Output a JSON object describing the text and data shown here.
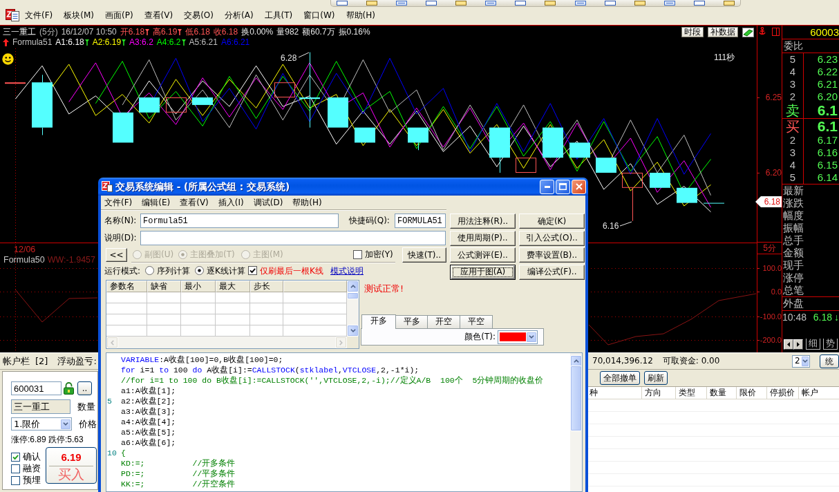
{
  "menu": [
    "文件(F)",
    "板块(M)",
    "画面(P)",
    "查看(V)",
    "交易(O)",
    "分析(A)",
    "工具(T)",
    "窗口(W)",
    "帮助(H)"
  ],
  "chart": {
    "quote": [
      {
        "kind": "name",
        "text": "三一重工",
        "marker": false
      },
      {
        "kind": "period",
        "text": "(5分)",
        "marker": false
      },
      {
        "kind": "info",
        "text": "16/12/07 10:50",
        "marker": false
      },
      {
        "kind": "price",
        "text": "开6.18",
        "marker": true
      },
      {
        "kind": "price",
        "text": "高6.19",
        "marker": true
      },
      {
        "kind": "price",
        "text": "低6.18",
        "marker": false
      },
      {
        "kind": "price",
        "text": "收6.18",
        "marker": false
      },
      {
        "kind": "stat",
        "text": "换0.00%",
        "marker": false
      },
      {
        "kind": "stat",
        "text": "量982",
        "marker": false
      },
      {
        "kind": "stat",
        "text": "额60.7万",
        "marker": false
      },
      {
        "kind": "stat",
        "text": "振0.16%",
        "marker": false
      }
    ],
    "buttons": [
      "时段",
      "补数据"
    ],
    "formula": "Formula51",
    "indicators": [
      {
        "label": "A1:6.18",
        "color": "#ffffff",
        "marker": true
      },
      {
        "label": "A2:6.19",
        "color": "#ffff00",
        "marker": true
      },
      {
        "label": "A3:6.2",
        "color": "#ff00ff",
        "marker": false
      },
      {
        "label": "A4:6.2",
        "color": "#00ff00",
        "marker": true
      },
      {
        "label": "A5:6.21",
        "color": "#c0c0c0",
        "marker": false
      },
      {
        "label": "A6:6.21",
        "color": "#0000ff",
        "marker": false
      }
    ],
    "countdown": "111秒",
    "high_label": "6.28",
    "low_label": "6.16",
    "date_label": "12/06",
    "lower_formula": "Formula50",
    "lower_value": "WW:-1.9457"
  },
  "axis": {
    "prices": [
      "6.25",
      "6.20"
    ],
    "last_price": "6.18",
    "period": "5分",
    "lower": [
      "100.0",
      "0.0",
      "-100.0",
      "-200.0"
    ]
  },
  "quote_panel": {
    "code": "60003",
    "ratio_label": "委比",
    "asks": [
      {
        "kind": "depth",
        "level": "5",
        "price": "6.23"
      },
      {
        "kind": "depth",
        "level": "4",
        "price": "6.22"
      },
      {
        "kind": "depth",
        "level": "3",
        "price": "6.21"
      },
      {
        "kind": "depth",
        "level": "2",
        "price": "6.20"
      },
      {
        "kind": "best",
        "level": "卖",
        "price": "6.1"
      }
    ],
    "bids": [
      {
        "kind": "best",
        "level": "买",
        "price": "6.1"
      },
      {
        "kind": "depth",
        "level": "2",
        "price": "6.17"
      },
      {
        "kind": "depth",
        "level": "3",
        "price": "6.16"
      },
      {
        "kind": "depth",
        "level": "4",
        "price": "6.15"
      },
      {
        "kind": "depth",
        "level": "5",
        "price": "6.14"
      }
    ],
    "fields": [
      "最新",
      "涨跌",
      "幅度",
      "振幅",
      "总手",
      "金额",
      "现手",
      "涨停",
      "总笔"
    ],
    "outer": "外盘",
    "tick": {
      "time": "10:48",
      "price": "6.18",
      "arrow": "↓"
    },
    "tabs": [
      "细",
      "势"
    ]
  },
  "account_bar": {
    "title": "帐户栏",
    "count": "[2]",
    "floating_label": "浮动盈亏:",
    "balance": "70,014,396.12",
    "available": "可取资金: 0.00",
    "account": "2",
    "button": "统"
  },
  "orders": {
    "buttons": [
      "全部撤单",
      "刷新"
    ],
    "columns": [
      "种",
      "方向",
      "类型",
      "数量",
      "限价",
      "停损价",
      "帐户"
    ]
  },
  "trade_form": {
    "code": "600031",
    "more_button": "..",
    "name": "三一重工",
    "quantity_label": "数量",
    "order_type": "1.限价",
    "price_label": "价格",
    "limits": "涨停:6.89 跌停:5.63",
    "options": [
      {
        "label": "确认",
        "checked": true
      },
      {
        "label": "融资",
        "checked": false
      },
      {
        "label": "预埋",
        "checked": false
      }
    ],
    "buy_price": "6.19",
    "buy_label": "买入"
  },
  "dialog": {
    "title": "交易系统编辑 - (所属公式组 : 交易系统)",
    "menu": [
      "文件(F)",
      "编辑(E)",
      "查看(V)",
      "插入(I)",
      "调试(D)",
      "帮助(H)"
    ],
    "name": {
      "label": "名称(N):",
      "value": "Formula51"
    },
    "shortcut": {
      "label": "快捷码(Q):",
      "value": "FORMULA51"
    },
    "description": {
      "label": "说明(D):"
    },
    "collapse_button": "<<",
    "chart_types": {
      "disabled": true,
      "options": [
        {
          "label": "副图(U)",
          "selected": false
        },
        {
          "label": "主图叠加(T)",
          "selected": true
        },
        {
          "label": "主图(M)",
          "selected": false
        }
      ]
    },
    "encrypt": {
      "label": "加密(Y)",
      "checked": false
    },
    "quick_button": "快速(T)..",
    "run_mode": {
      "label": "运行模式:",
      "options": [
        {
          "label": "序列计算",
          "selected": false
        },
        {
          "label": "逐K线计算",
          "selected": true
        }
      ]
    },
    "refresh_last": {
      "label": "仅刷最后一根K线",
      "checked": true
    },
    "mode_link": "模式说明",
    "buttons": [
      {
        "label": "用法注释(R)..",
        "focused": false
      },
      {
        "label": "确定(K)",
        "focused": false
      },
      {
        "label": "使用周期(P)..",
        "focused": false
      },
      {
        "label": "引入公式(O)..",
        "focused": false
      },
      {
        "label": "公式测评(E)..",
        "focused": false
      },
      {
        "label": "费率设置(B)..",
        "focused": false
      },
      {
        "label": "应用于图(A)",
        "focused": true
      },
      {
        "label": "编译公式(F)..",
        "focused": false
      }
    ],
    "param_columns": [
      "参数名",
      "缺省",
      "最小",
      "最大",
      "步长"
    ],
    "status": "测试正常!",
    "signal_tabs": [
      {
        "label": "开多",
        "selected": true
      },
      {
        "label": "平多",
        "selected": false
      },
      {
        "label": "开空",
        "selected": false
      },
      {
        "label": "平空",
        "selected": false
      }
    ],
    "color_picker": {
      "label": "颜色(T):",
      "color": "#ff0000"
    },
    "code": [
      {
        "segments": [
          {
            "kind": "keyword",
            "text": "VARIABLE"
          },
          {
            "kind": "plain",
            "text": ":A收盘[100]=0,B收盘[100]=0;"
          }
        ]
      },
      {
        "segments": [
          {
            "kind": "keyword",
            "text": "for"
          },
          {
            "kind": "plain",
            "text": " i=1 "
          },
          {
            "kind": "keyword",
            "text": "to"
          },
          {
            "kind": "plain",
            "text": " 100 "
          },
          {
            "kind": "keyword",
            "text": "do"
          },
          {
            "kind": "plain",
            "text": " A收盘[i]:="
          },
          {
            "kind": "keyword",
            "text": "CALLSTOCK"
          },
          {
            "kind": "plain",
            "text": "("
          },
          {
            "kind": "keyword",
            "text": "stklabel"
          },
          {
            "kind": "plain",
            "text": ","
          },
          {
            "kind": "keyword",
            "text": "VTCLOSE"
          },
          {
            "kind": "plain",
            "text": ",2,-1*i);"
          }
        ]
      },
      {
        "segments": [
          {
            "kind": "comment",
            "text": "//for i=1 to 100 do B收盘[i]:=CALLSTOCK('',VTCLOSE,2,-i);//定义A/B  100个  5分钟周期的收盘价"
          }
        ]
      },
      {
        "segments": [
          {
            "kind": "plain",
            "text": "a1:A收盘[1];"
          }
        ]
      },
      {
        "number": "5",
        "segments": [
          {
            "kind": "plain",
            "text": "a2:A收盘[2];"
          }
        ]
      },
      {
        "segments": [
          {
            "kind": "plain",
            "text": "a3:A收盘[3];"
          }
        ]
      },
      {
        "segments": [
          {
            "kind": "plain",
            "text": "a4:A收盘[4];"
          }
        ]
      },
      {
        "segments": [
          {
            "kind": "plain",
            "text": "a5:A收盘[5];"
          }
        ]
      },
      {
        "segments": [
          {
            "kind": "plain",
            "text": "a6:A收盘[6];"
          }
        ]
      },
      {
        "number": "10",
        "segments": [
          {
            "kind": "comment",
            "text": "{"
          }
        ]
      },
      {
        "segments": [
          {
            "kind": "comment",
            "text": "KD:=;          //开多条件"
          }
        ]
      },
      {
        "segments": [
          {
            "kind": "comment",
            "text": "PD:=;          //平多条件"
          }
        ]
      },
      {
        "segments": [
          {
            "kind": "comment",
            "text": "KK:=;          //开空条件"
          }
        ]
      }
    ]
  }
}
